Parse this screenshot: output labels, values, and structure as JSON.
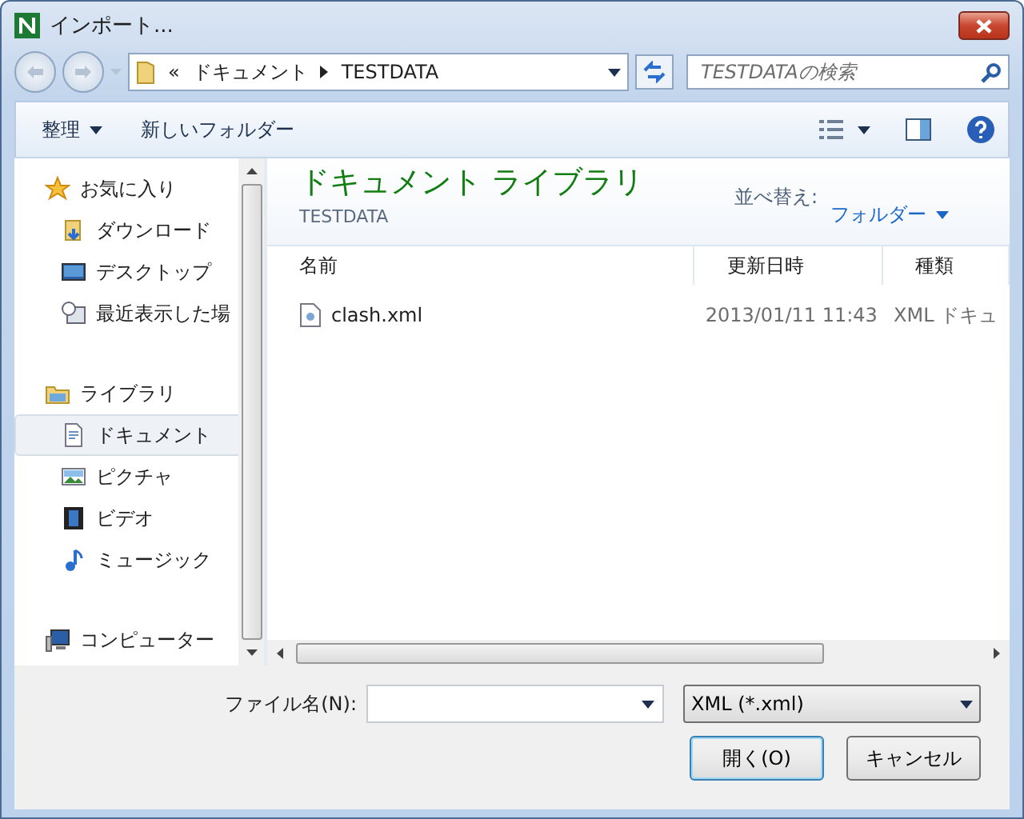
{
  "window": {
    "title": "インポート..."
  },
  "address": {
    "overflow": "«",
    "crumbs": [
      "ドキュメント",
      "TESTDATA"
    ]
  },
  "search": {
    "placeholder": "TESTDATAの検索"
  },
  "toolbar": {
    "organize": "整理",
    "new_folder": "新しいフォルダー"
  },
  "nav": [
    {
      "label": "お気に入り",
      "kind": "group",
      "selected": false,
      "children": [
        {
          "label": "ダウンロード",
          "kind": "item",
          "selected": false
        },
        {
          "label": "デスクトップ",
          "kind": "item",
          "selected": false
        },
        {
          "label": "最近表示した場",
          "kind": "item",
          "selected": false
        }
      ]
    },
    {
      "label": "ライブラリ",
      "kind": "group",
      "selected": false,
      "children": [
        {
          "label": "ドキュメント",
          "kind": "item",
          "selected": true
        },
        {
          "label": "ピクチャ",
          "kind": "item",
          "selected": false
        },
        {
          "label": "ビデオ",
          "kind": "item",
          "selected": false
        },
        {
          "label": "ミュージック",
          "kind": "item",
          "selected": false
        }
      ]
    },
    {
      "label": "コンピューター",
      "kind": "group",
      "selected": false
    }
  ],
  "library": {
    "title": "ドキュメント ライブラリ",
    "subtitle": "TESTDATA",
    "sort_label": "並べ替え:",
    "sort_value": "フォルダー"
  },
  "table": {
    "columns": [
      "名前",
      "更新日時",
      "種類"
    ],
    "rows": [
      {
        "cells": [
          "clash.xml",
          "2013/01/11 11:43",
          "XML ドキュ"
        ],
        "selected": false
      }
    ]
  },
  "footer": {
    "filename_label": "ファイル名(N):",
    "filter": "XML (*.xml)",
    "buttons": [
      "開く(O)",
      "キャンセル"
    ]
  }
}
